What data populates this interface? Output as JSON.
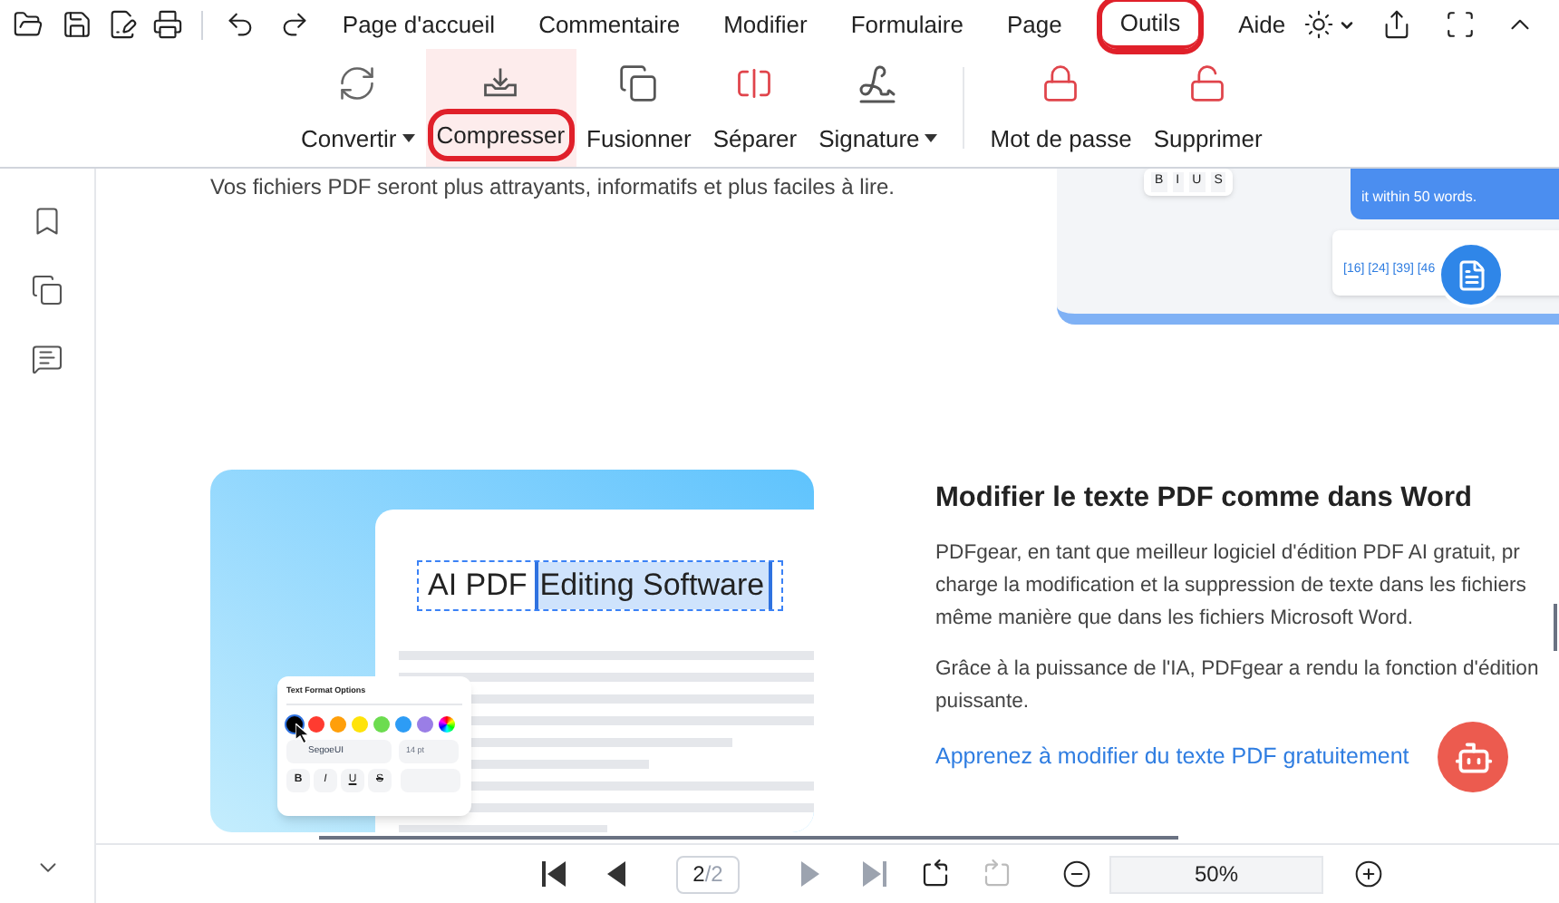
{
  "menu_tabs": [
    {
      "label": "Page d'accueil",
      "selected": false,
      "circled": false
    },
    {
      "label": "Commentaire",
      "selected": false,
      "circled": false
    },
    {
      "label": "Modifier",
      "selected": false,
      "circled": false
    },
    {
      "label": "Formulaire",
      "selected": false,
      "circled": false
    },
    {
      "label": "Page",
      "selected": false,
      "circled": false
    },
    {
      "label": "Outils",
      "selected": true,
      "circled": true
    },
    {
      "label": "Aide",
      "selected": false,
      "circled": false
    }
  ],
  "ribbon_groups": [
    [
      {
        "kind": "convert",
        "label": "Convertir",
        "dropdown": true,
        "hovered": false,
        "circled": false
      },
      {
        "kind": "compress",
        "label": "Compresser",
        "dropdown": false,
        "hovered": true,
        "circled": true
      },
      {
        "kind": "merge",
        "label": "Fusionner",
        "dropdown": false,
        "hovered": false,
        "circled": false
      },
      {
        "kind": "split",
        "label": "Séparer",
        "dropdown": false,
        "hovered": false,
        "circled": false
      },
      {
        "kind": "sign",
        "label": "Signature",
        "dropdown": true,
        "hovered": false,
        "circled": false
      }
    ],
    [
      {
        "kind": "password",
        "label": "Mot de passe",
        "dropdown": false,
        "hovered": false,
        "circled": false
      },
      {
        "kind": "unlock",
        "label": "Supprimer",
        "dropdown": false,
        "hovered": false,
        "circled": false
      }
    ]
  ],
  "document": {
    "intro_text": "Vos fichiers PDF seront plus attrayants, informatifs et plus faciles à lire.",
    "top_illustration": {
      "mini_toolbar": [
        "B",
        "I",
        "U",
        "S"
      ],
      "bubble_text": "it within 50 words.",
      "citations": "[16] [24] [39] [46"
    },
    "editor_illustration": {
      "headline_plain": "AI PDF",
      "headline_selected": "Editing Software",
      "panel_title": "Text Format Options",
      "swatches": [
        {
          "kind": "solid",
          "color": "#000000",
          "selected": true
        },
        {
          "kind": "solid",
          "color": "#ff3b30",
          "selected": false
        },
        {
          "kind": "solid",
          "color": "#ff9f0a",
          "selected": false
        },
        {
          "kind": "solid",
          "color": "#ffe30a",
          "selected": false
        },
        {
          "kind": "solid",
          "color": "#6cdc4f",
          "selected": false
        },
        {
          "kind": "solid",
          "color": "#2d9cf5",
          "selected": false
        },
        {
          "kind": "solid",
          "color": "#9a7ee6",
          "selected": false
        },
        {
          "kind": "picker",
          "selected": false
        }
      ],
      "font": "SegoeUI",
      "size": "14 pt",
      "format_buttons": [
        {
          "kind": "bold",
          "label": "B"
        },
        {
          "kind": "italic",
          "label": "I"
        },
        {
          "kind": "underline",
          "label": "U"
        },
        {
          "kind": "strike",
          "label": "S"
        }
      ]
    },
    "feature": {
      "heading": "Modifier le texte PDF comme dans Word",
      "paragraphs": [
        [
          "PDFgear, en tant que meilleur logiciel d'édition PDF AI gratuit, pr",
          "charge la modification et la suppression de texte dans les fichiers",
          "même manière que dans les fichiers Microsoft Word."
        ],
        [
          "Grâce à la puissance de l'IA, PDFgear a rendu la fonction d'édition",
          "puissante."
        ]
      ],
      "link": "Apprenez à modifier du texte PDF gratuitement"
    }
  },
  "pager": {
    "current": "2",
    "total": "/2",
    "zoom": "50%"
  }
}
